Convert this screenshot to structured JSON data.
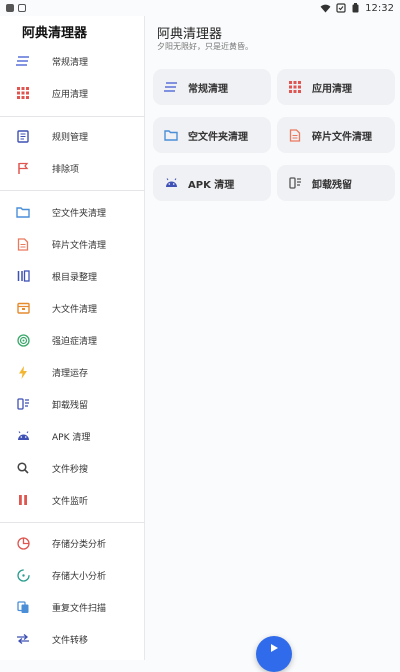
{
  "status_bar": {
    "time": "12:32"
  },
  "drawer": {
    "app_title": "阿典清理器",
    "items": [
      {
        "label": "常规清理",
        "icon": "lines-icon"
      },
      {
        "label": "应用清理",
        "icon": "grid-icon"
      },
      {
        "label": "规则管理",
        "icon": "book-icon"
      },
      {
        "label": "排除项",
        "icon": "flag-icon"
      },
      {
        "label": "空文件夹清理",
        "icon": "folder-icon"
      },
      {
        "label": "碎片文件清理",
        "icon": "document-icon"
      },
      {
        "label": "根目录整理",
        "icon": "columns-icon"
      },
      {
        "label": "大文件清理",
        "icon": "box-icon"
      },
      {
        "label": "强迫症清理",
        "icon": "target-icon"
      },
      {
        "label": "清理运存",
        "icon": "bolt-icon"
      },
      {
        "label": "卸载残留",
        "icon": "uninstall-icon"
      },
      {
        "label": "APK 清理",
        "icon": "android-icon"
      },
      {
        "label": "文件秒搜",
        "icon": "search-icon"
      },
      {
        "label": "文件监听",
        "icon": "pause-icon"
      },
      {
        "label": "存储分类分析",
        "icon": "pie-icon"
      },
      {
        "label": "存储大小分析",
        "icon": "gauge-icon"
      },
      {
        "label": "重复文件扫描",
        "icon": "copy-icon"
      },
      {
        "label": "文件转移",
        "icon": "transfer-icon"
      }
    ]
  },
  "main": {
    "title": "阿典清理器",
    "subtitle": "夕阳无限好，只是近黄昏。",
    "cards": [
      {
        "label": "常规清理",
        "icon": "lines-icon"
      },
      {
        "label": "应用清理",
        "icon": "grid-icon"
      },
      {
        "label": "空文件夹清理",
        "icon": "folder-icon"
      },
      {
        "label": "碎片文件清理",
        "icon": "document-icon"
      },
      {
        "label": "APK 清理",
        "icon": "android-icon"
      },
      {
        "label": "卸载残留",
        "icon": "uninstall-icon"
      }
    ]
  },
  "colors": {
    "accent": "#2f6bea",
    "lines": "#5a72d8",
    "grid": "#e0554f",
    "folder": "#4a8ed8",
    "document": "#e9785d",
    "bolt": "#f2b632",
    "target": "#3aa86a"
  }
}
